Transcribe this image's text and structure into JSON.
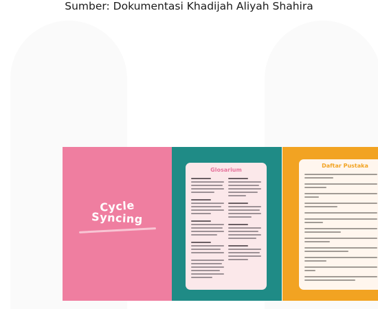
{
  "caption": "Sumber: Dokumentasi Khadijah Aliyah Shahira",
  "cover": {
    "title_line1": "Cycle",
    "title_line2": "Syncing"
  },
  "glossary": {
    "title": "Glosarium"
  },
  "bibliography": {
    "title": "Daftar Pustaka"
  },
  "colors": {
    "cover_bg": "#ef7ea0",
    "glossary_bg": "#1f8b86",
    "glossary_card": "#fbe8ea",
    "glossary_title": "#e6739c",
    "bibliography_bg": "#f2a322",
    "bibliography_card": "#fff6ee"
  }
}
